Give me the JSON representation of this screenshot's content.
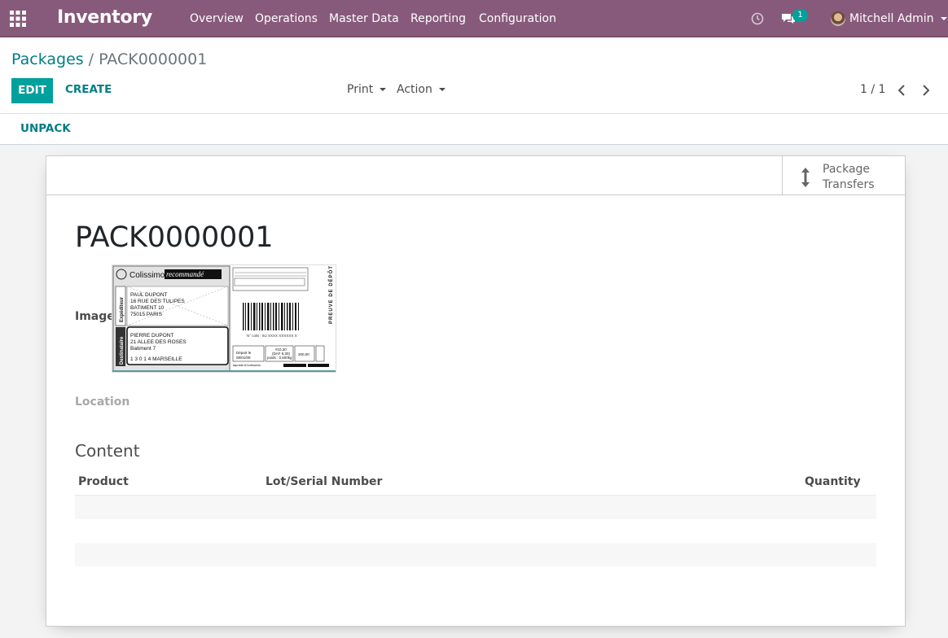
{
  "navbar": {
    "app_name": "Inventory",
    "menu": [
      "Overview",
      "Operations",
      "Master Data",
      "Reporting",
      "Configuration"
    ],
    "chat_badge": "1",
    "user_name": "Mitchell Admin",
    "color": "#875a7b"
  },
  "breadcrumb": {
    "parent": "Packages",
    "separator": "/",
    "current": "PACK0000001"
  },
  "toolbar": {
    "edit_label": "EDIT",
    "create_label": "CREATE",
    "print_label": "Print",
    "action_label": "Action",
    "pager": "1 / 1"
  },
  "statusbar": {
    "unpack_label": "UNPACK"
  },
  "stat_button": {
    "label_line1": "Package",
    "label_line2": "Transfers"
  },
  "form": {
    "title": "PACK0000001",
    "image_label": "Image",
    "location_label": "Location",
    "content_title": "Content",
    "columns": [
      "Product",
      "Lot/Serial Number",
      "Quantity"
    ]
  },
  "label_image": {
    "brand": "Colissimo",
    "brand_tag": "recommandé",
    "sender_lines": [
      "PAUL DUPONT",
      "16 RUE DES TULIPES",
      "BATIMENT 10",
      "75015 PARIS"
    ],
    "recipient_lines": [
      "PIERRE DUPONT",
      "21 ALLEE DES ROSES",
      "Batiment 7"
    ],
    "recipient_city": "1 3 0 1 4   MARSEILLE",
    "side_text": "PREUVE DE DÉPÔT",
    "expediteur": "Expéditeur",
    "destinataire": "Destinataire",
    "colis_no": "N° colis : 8U XXXX XXXXXX X",
    "date_label": "Départ le",
    "date_value": "08/01/09",
    "price": "#10,30",
    "price_sub": "(DAF 5,30)",
    "weight": "poids : 0,500kg",
    "amount": "300,00",
    "website": "laposte.fr/colissimo"
  },
  "colors": {
    "accent": "#00a09d",
    "link": "#017e84"
  }
}
